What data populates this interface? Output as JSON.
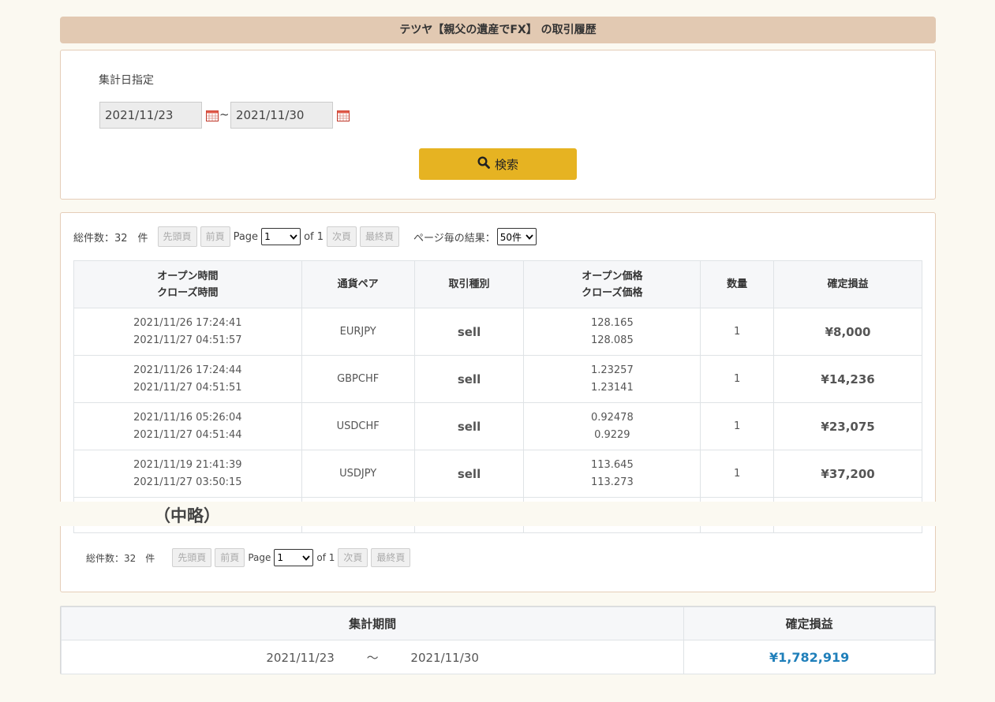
{
  "page_title": "テツヤ【親父の遺産でFX】 の取引履歴",
  "search": {
    "label": "集計日指定",
    "date_from": "2021/11/23",
    "date_to": "2021/11/30",
    "separator": "~",
    "button_label": "検索"
  },
  "pager": {
    "total_label": "総件数：32　件",
    "total_label_bottom": "総件数：32　件",
    "first": "先頭頁",
    "prev": "前頁",
    "page_word": "Page",
    "current_page": "1",
    "of_label": "of 1",
    "next": "次頁",
    "last": "最終頁",
    "per_page_label": "ページ毎の結果：",
    "per_page_value": "50件"
  },
  "table": {
    "headers": {
      "time_open": "オープン時間",
      "time_close": "クローズ時間",
      "pair": "通貨ペア",
      "type": "取引種別",
      "price_open": "オープン価格",
      "price_close": "クローズ価格",
      "qty": "数量",
      "pl": "確定損益"
    },
    "rows": [
      {
        "open_time": "2021/11/26 17:24:41",
        "close_time": "2021/11/27 04:51:57",
        "pair": "EURJPY",
        "type": "sell",
        "open_price": "128.165",
        "close_price": "128.085",
        "qty": "1",
        "pl": "¥8,000"
      },
      {
        "open_time": "2021/11/26 17:24:44",
        "close_time": "2021/11/27 04:51:51",
        "pair": "GBPCHF",
        "type": "sell",
        "open_price": "1.23257",
        "close_price": "1.23141",
        "qty": "1",
        "pl": "¥14,236"
      },
      {
        "open_time": "2021/11/16 05:26:04",
        "close_time": "2021/11/27 04:51:44",
        "pair": "USDCHF",
        "type": "sell",
        "open_price": "0.92478",
        "close_price": "0.9229",
        "qty": "1",
        "pl": "¥23,075"
      },
      {
        "open_time": "2021/11/19 21:41:39",
        "close_time": "2021/11/27 03:50:15",
        "pair": "USDJPY",
        "type": "sell",
        "open_price": "113.645",
        "close_price": "113.273",
        "qty": "1",
        "pl": "¥37,200"
      }
    ]
  },
  "omitted_label": "（中略）",
  "summary": {
    "period_header": "集計期間",
    "pl_header": "確定損益",
    "period_from": "2021/11/23",
    "period_sep": "〜",
    "period_to": "2021/11/30",
    "total_pl": "¥1,782,919"
  },
  "colors": {
    "title_bar": "#e2c9b2",
    "search_button": "#e6b322",
    "sell": "#d53a3a",
    "profit": "#1f7fba"
  }
}
